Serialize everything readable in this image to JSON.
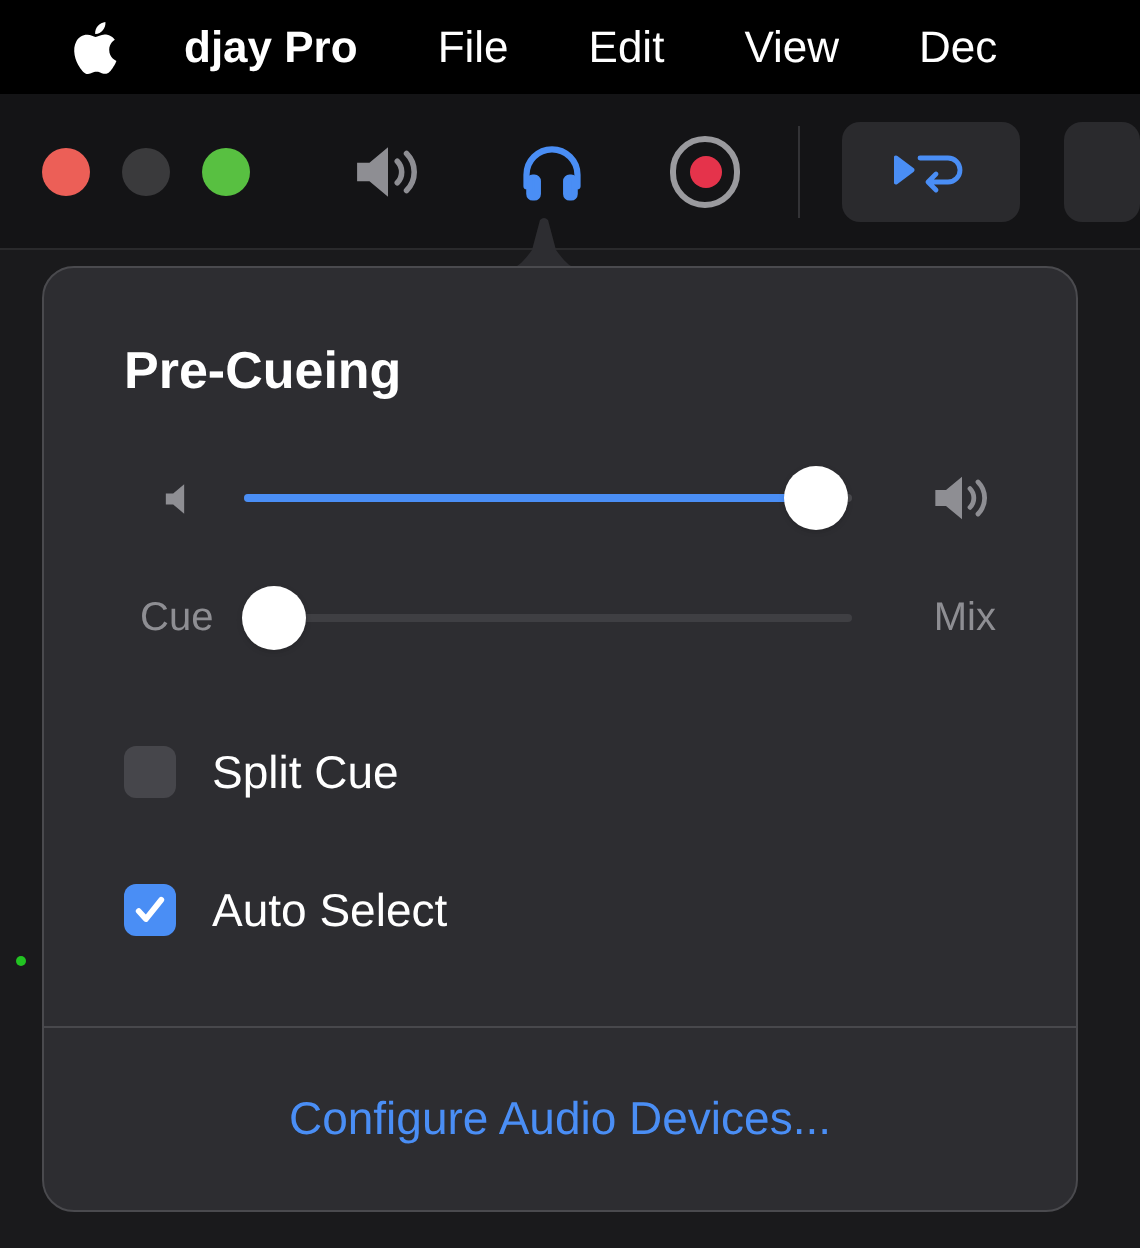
{
  "menu_bar": {
    "app_name": "djay Pro",
    "items": [
      "File",
      "Edit",
      "View",
      "Dec"
    ]
  },
  "popover": {
    "title": "Pre-Cueing",
    "volume": {
      "level": 0.94
    },
    "cue_mix": {
      "left_label": "Cue",
      "right_label": "Mix",
      "level": 0.05
    },
    "options": [
      {
        "label": "Split Cue",
        "checked": false
      },
      {
        "label": "Auto Select",
        "checked": true
      }
    ],
    "link": "Configure Audio Devices..."
  }
}
